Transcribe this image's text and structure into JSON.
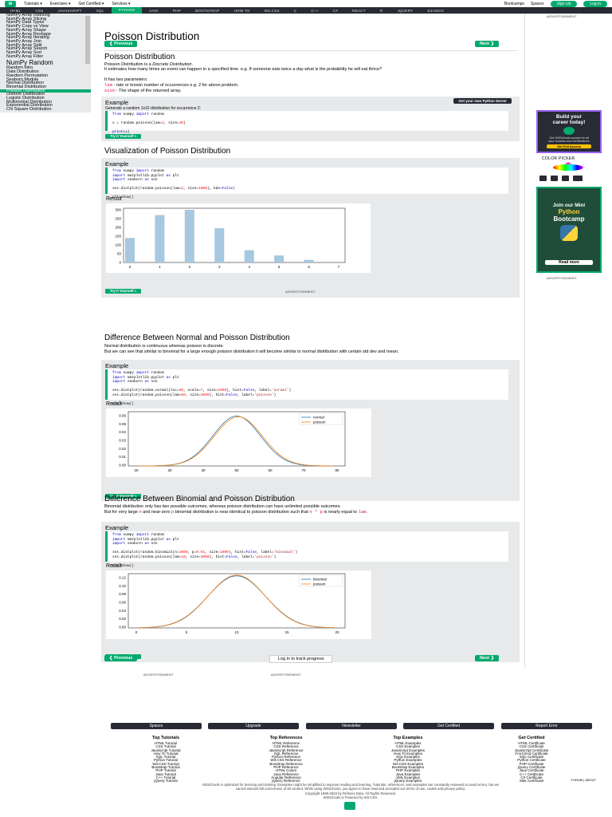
{
  "topbar": {
    "logo": "w",
    "nav": [
      "Tutorials ▾",
      "Exercises ▾",
      "Get Certified ▾",
      "Services ▾"
    ],
    "right": [
      "Bootcamps",
      "Spaces",
      "Sign Up",
      "Log in"
    ]
  },
  "nav2": [
    "HTML",
    "CSS",
    "JAVASCRIPT",
    "SQL",
    "PYTHON",
    "JAVA",
    "PHP",
    "BOOTSTRAP",
    "HOW TO",
    "W3.CSS",
    "C",
    "C++",
    "C#",
    "REACT",
    "R",
    "JQUERY",
    "DJANGO"
  ],
  "sidebar": {
    "items_top": [
      "NumPy Array Indexing",
      "NumPy Array Slicing",
      "NumPy Data Types",
      "NumPy Copy vs View",
      "NumPy Array Shape",
      "NumPy Array Reshape",
      "NumPy Array Iterating",
      "NumPy Array Join",
      "NumPy Array Split",
      "NumPy Array Search",
      "NumPy Array Sort",
      "NumPy Array Filter"
    ],
    "heading": "NumPy Random",
    "items_bottom": [
      "Random Intro",
      "Data Distribution",
      "Random Permutation",
      "Seaborn Module",
      "Normal Distribution",
      "Binomial Distribution",
      "Poisson Distribution",
      "Uniform Distribution",
      "Logistic Distribution",
      "Multinomial Distribution",
      "Exponential Distribution",
      "Chi Square Distribution"
    ]
  },
  "page": {
    "title": "Poisson Distribution",
    "prev": "❮ Previous",
    "next": "Next ❯",
    "h_poisson": "Poisson Distribution",
    "p1a": "Poisson Distribution is a ",
    "p1b": "Discrete Distribution",
    "p1c": ".",
    "p2": "It estimates how many times an event can happen in a specified time. e.g. If someone eats twice a day what is the probability he will eat thrice?",
    "p3": "It has two parameters:",
    "param1_code": "lam",
    "param1_text": " - rate or known number of occurrences e.g. 2 for above problem.",
    "param2_code": "size",
    "param2_text": " - The shape of the returned array.",
    "example": "Example",
    "ex1_desc": "Generate a random 1x10 distribution for occurrence 2:",
    "get_server": "Get your own Python Server",
    "try": "Try it Yourself »",
    "h_vis": "Visualization of Poisson Distribution",
    "result": "Result",
    "advert": "ADVERTISEMENT",
    "h_normal": "Difference Between Normal and Poisson Distribution",
    "pn1": "Normal distribution is continuous whereas poisson is discrete.",
    "pn2": "But we can see that similar to binomial for a large enough poisson distribution it will become similar to normal distribution with certain std dev and mean.",
    "h_binom": "Difference Between Binomial and Poisson Distribution",
    "pb1": "Binomial distribution only has two possible outcomes, whereas poisson distribution can have unlimited possible outcomes.",
    "pb2a": "But for very large ",
    "pb2b": "n",
    "pb2c": " and near-zero ",
    "pb2d": "p",
    "pb2e": " binomial distribution is near identical to poisson distribution such that ",
    "pb2f": "n * p",
    "pb2g": " is nearly equal to ",
    "pb2h": "lam",
    "pb2i": ".",
    "track": "Log in to track progress"
  },
  "right": {
    "advert": "ADVERTISEMENT",
    "ad1": [
      "Build your",
      "career today!"
    ],
    "ad1_sub": "Get W3Schools access for all your courses and certifications",
    "ad1_btn": "Get Full Access",
    "color_picker": "COLOR PICKER",
    "ad2": [
      "Join our Mini",
      "Python",
      "Bootcamp"
    ],
    "ad2_btn": "Read more"
  },
  "footer": {
    "buttons": [
      "Spaces",
      "Upgrade",
      "Newsletter",
      "Get Certified",
      "Report Error"
    ],
    "cols": [
      {
        "h": "Top Tutorials",
        "l": [
          "HTML Tutorial",
          "CSS Tutorial",
          "JavaScript Tutorial",
          "How To Tutorial",
          "SQL Tutorial",
          "Python Tutorial",
          "W3.CSS Tutorial",
          "Bootstrap Tutorial",
          "PHP Tutorial",
          "Java Tutorial",
          "C++ Tutorial",
          "jQuery Tutorial"
        ]
      },
      {
        "h": "Top References",
        "l": [
          "HTML Reference",
          "CSS Reference",
          "JavaScript Reference",
          "SQL Reference",
          "Python Reference",
          "W3.CSS Reference",
          "Bootstrap Reference",
          "PHP Reference",
          "HTML Colors",
          "Java Reference",
          "Angular Reference",
          "jQuery Reference"
        ]
      },
      {
        "h": "Top Examples",
        "l": [
          "HTML Examples",
          "CSS Examples",
          "JavaScript Examples",
          "How To Examples",
          "SQL Examples",
          "Python Examples",
          "W3.CSS Examples",
          "Bootstrap Examples",
          "PHP Examples",
          "Java Examples",
          "XML Examples",
          "jQuery Examples"
        ]
      },
      {
        "h": "Get Certified",
        "l": [
          "HTML Certificate",
          "CSS Certificate",
          "JavaScript Certificate",
          "Front End Certificate",
          "SQL Certificate",
          "Python Certificate",
          "PHP Certificate",
          "jQuery Certificate",
          "Java Certificate",
          "C++ Certificate",
          "C# Certificate",
          "XML Certificate"
        ]
      }
    ],
    "links": "FORUM | ABOUT",
    "copy1": "W3Schools is optimized for learning and training. Examples might be simplified to improve reading and learning. Tutorials, references, and examples are constantly reviewed to avoid errors, but we",
    "copy2": "cannot warrant full correctness of all content. While using W3Schools, you agree to have read and accepted our terms of use, cookie and privacy policy.",
    "copy3": "Copyright 1999-2023 by Refsnes Data. All Rights Reserved.",
    "copy4": "W3Schools is Powered by W3.CSS."
  },
  "chart_data": [
    {
      "type": "bar",
      "categories": [
        "0",
        "1",
        "2",
        "3",
        "4",
        "5",
        "6",
        "7"
      ],
      "values": [
        140,
        270,
        300,
        195,
        70,
        40,
        15,
        0
      ],
      "ylim": [
        0,
        300
      ],
      "yticks": [
        "300",
        "250",
        "200",
        "150",
        "100",
        "50",
        "0"
      ],
      "xticks": [
        "0",
        "1",
        "2",
        "3",
        "4",
        "5",
        "6",
        "7"
      ]
    },
    {
      "type": "line",
      "xticks": [
        "20",
        "30",
        "40",
        "50",
        "60",
        "70",
        "80"
      ],
      "yticks": [
        "0.06",
        "0.05",
        "0.04",
        "0.03",
        "0.02",
        "0.01",
        "0.00"
      ],
      "series": [
        {
          "name": "normal",
          "color": "#1f77b4"
        },
        {
          "name": "poisson",
          "color": "#ff7f0e"
        }
      ]
    },
    {
      "type": "line",
      "xticks": [
        "0",
        "5",
        "10",
        "15",
        "20"
      ],
      "yticks": [
        "0.12",
        "0.10",
        "0.08",
        "0.06",
        "0.04",
        "0.02",
        "0.00"
      ],
      "series": [
        {
          "name": "binomial",
          "color": "#1f77b4"
        },
        {
          "name": "poisson",
          "color": "#ff7f0e"
        }
      ]
    }
  ]
}
